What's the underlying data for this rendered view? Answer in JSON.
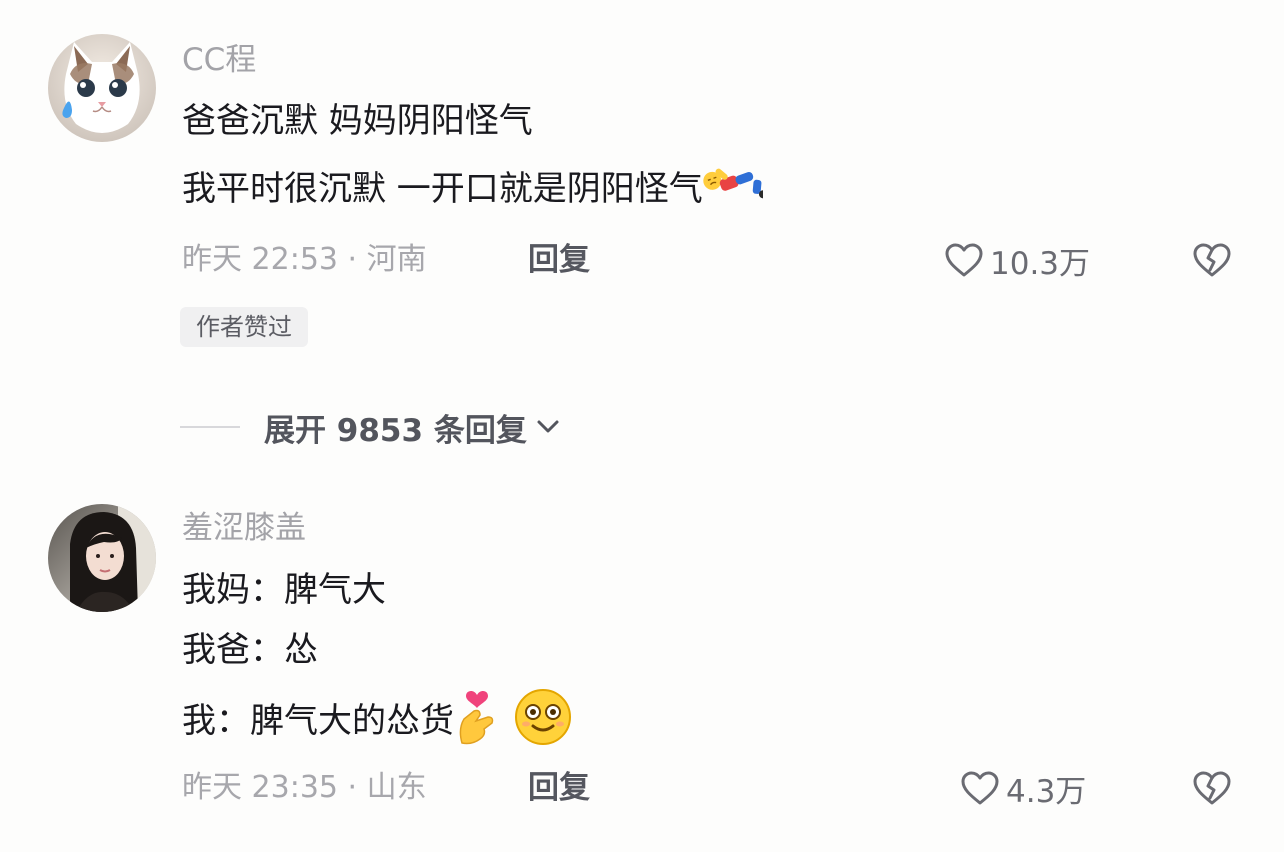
{
  "comments": [
    {
      "username": "CC程",
      "lines": [
        "爸爸沉默 妈妈阴阳怪气",
        "我平时很沉默 一开口就是阴阳怪气"
      ],
      "meta": "昨天 22:53 · 河南",
      "reply_label": "回复",
      "likes": "10.3万",
      "badge": "作者赞过",
      "expand_label": "展开 9853 条回复",
      "emoji": [
        "falling-person-emoji"
      ]
    },
    {
      "username": "羞涩膝盖",
      "lines": [
        "我妈：脾气大",
        "我爸：怂",
        "我：脾气大的怂货"
      ],
      "meta": "昨天 23:35 · 山东",
      "reply_label": "回复",
      "likes": "4.3万",
      "emoji": [
        "finger-heart-emoji",
        "smiling-face-emoji"
      ]
    }
  ],
  "icons": {
    "like": "heart-outline-icon",
    "dislike": "broken-heart-icon",
    "expand": "chevron-down-icon"
  },
  "colors": {
    "background": "#fdfdfc",
    "secondary_text": "#a3a3a8",
    "primary_text": "#1a1a1f"
  }
}
